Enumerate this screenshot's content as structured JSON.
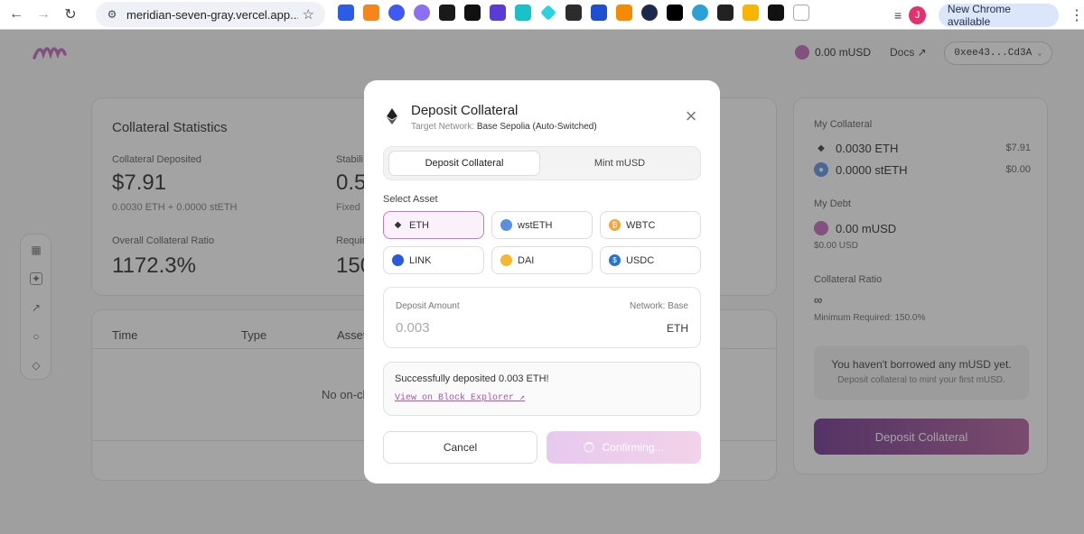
{
  "browser": {
    "url": "meridian-seven-gray.vercel.app...",
    "avatar_letter": "J",
    "new_chrome": "New Chrome available"
  },
  "header": {
    "balance": "0.00 mUSD",
    "docs": "Docs ↗",
    "address": "0xee43...Cd3A"
  },
  "stats": {
    "title": "Collateral Statistics",
    "deposited_label": "Collateral Deposited",
    "deposited_value": "$7.91",
    "deposited_sub": "0.0030 ETH + 0.0000 stETH",
    "stab_label": "Stabili",
    "stab_value": "0.5",
    "stab_sub": "Fixed",
    "ratio_label": "Overall Collateral Ratio",
    "ratio_value": "1172.3%",
    "req_label": "Requir",
    "req_value": "150"
  },
  "history": {
    "col_time": "Time",
    "col_type": "Type",
    "col_asset": "Asset",
    "empty": "No on-ch"
  },
  "right": {
    "my_collateral": "My Collateral",
    "eth_amount": "0.0030 ETH",
    "eth_usd": "$7.91",
    "steth_amount": "0.0000 stETH",
    "steth_usd": "$0.00",
    "my_debt": "My Debt",
    "debt_amount": "0.00 mUSD",
    "debt_usd": "$0.00 USD",
    "ratio_label": "Collateral Ratio",
    "ratio_value": "∞",
    "min_req": "Minimum Required: 150.0%",
    "note_title": "You haven't borrowed any mUSD yet.",
    "note_sub": "Deposit collateral to mint your first mUSD.",
    "deposit_button": "Deposit Collateral"
  },
  "modal": {
    "title": "Deposit Collateral",
    "network_prefix": "Target Network:",
    "network_value": "Base Sepolia (Auto-Switched)",
    "tab_deposit": "Deposit Collateral",
    "tab_mint": "Mint mUSD",
    "select_asset": "Select Asset",
    "assets": [
      "ETH",
      "wstETH",
      "WBTC",
      "LINK",
      "DAI",
      "USDC"
    ],
    "amount_label": "Deposit Amount",
    "amount_network": "Network: Base",
    "amount_value": "0.003",
    "amount_token": "ETH",
    "success_msg": "Successfully deposited 0.003 ETH!",
    "explorer_link": "View on Block Explorer ↗",
    "cancel": "Cancel",
    "confirm": "Confirming..."
  }
}
